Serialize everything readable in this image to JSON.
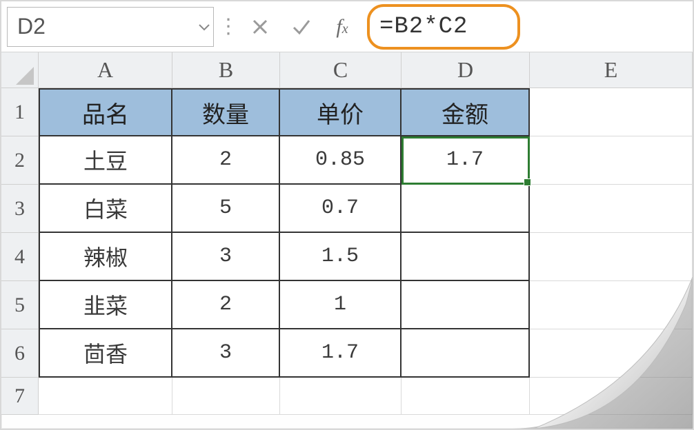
{
  "formula_bar": {
    "cell_ref": "D2",
    "formula": "=B2*C2"
  },
  "columns": [
    "A",
    "B",
    "C",
    "D",
    "E"
  ],
  "row_numbers": [
    "1",
    "2",
    "3",
    "4",
    "5",
    "6",
    "7"
  ],
  "headers": {
    "A": "品名",
    "B": "数量",
    "C": "单价",
    "D": "金额"
  },
  "rows": [
    {
      "A": "土豆",
      "B": "2",
      "C": "0.85",
      "D": "1.7"
    },
    {
      "A": "白菜",
      "B": "5",
      "C": "0.7",
      "D": ""
    },
    {
      "A": "辣椒",
      "B": "3",
      "C": "1.5",
      "D": ""
    },
    {
      "A": "韭菜",
      "B": "2",
      "C": "1",
      "D": ""
    },
    {
      "A": "茴香",
      "B": "3",
      "C": "1.7",
      "D": ""
    }
  ],
  "active_cell": "D2",
  "chart_data": {
    "type": "table",
    "columns": [
      "品名",
      "数量",
      "单价",
      "金额"
    ],
    "rows": [
      [
        "土豆",
        2,
        0.85,
        1.7
      ],
      [
        "白菜",
        5,
        0.7,
        null
      ],
      [
        "辣椒",
        3,
        1.5,
        null
      ],
      [
        "韭菜",
        2,
        1,
        null
      ],
      [
        "茴香",
        3,
        1.7,
        null
      ]
    ],
    "formula_cell": {
      "ref": "D2",
      "formula": "=B2*C2"
    }
  }
}
